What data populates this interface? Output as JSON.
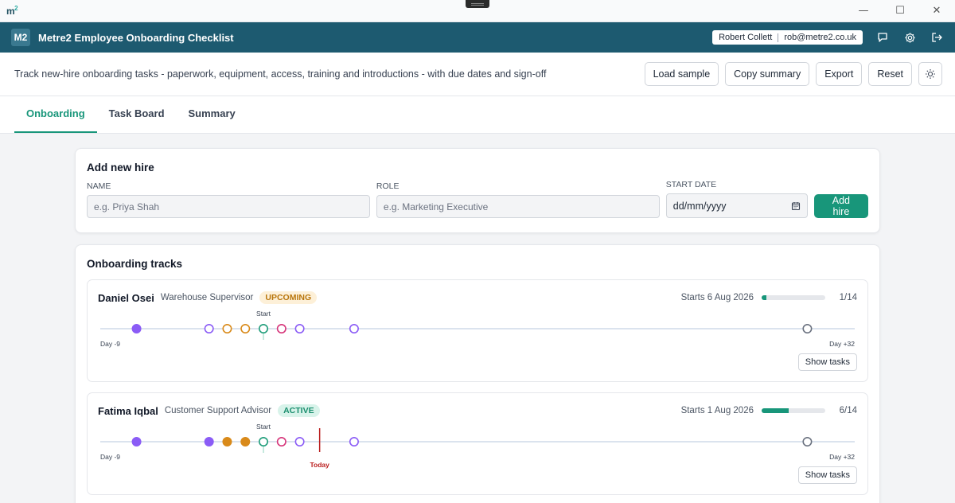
{
  "window": {
    "logo": "m",
    "logo_sup": "2",
    "minimize": "—",
    "maximize": "☐",
    "close": "✕"
  },
  "header": {
    "badge": "M2",
    "title": "Metre2 Employee Onboarding Checklist",
    "user_name": "Robert Collett",
    "user_email": "rob@metre2.co.uk"
  },
  "subheader": {
    "description": "Track new-hire onboarding tasks - paperwork, equipment, access, training and introductions - with due dates and sign-off",
    "load_sample": "Load sample",
    "copy_summary": "Copy summary",
    "export": "Export",
    "reset": "Reset"
  },
  "tabs": [
    {
      "label": "Onboarding",
      "active": true
    },
    {
      "label": "Task Board",
      "active": false
    },
    {
      "label": "Summary",
      "active": false
    }
  ],
  "add_hire": {
    "title": "Add new hire",
    "name_label": "NAME",
    "name_placeholder": "e.g. Priya Shah",
    "role_label": "ROLE",
    "role_placeholder": "e.g. Marketing Executive",
    "date_label": "START DATE",
    "date_placeholder": "dd/mm/yyyy",
    "button": "Add hire"
  },
  "tracks": {
    "title": "Onboarding tracks",
    "colors": {
      "purple": "#8b5cf6",
      "orange": "#d98a1a",
      "green": "#1f9d7a",
      "pink": "#d6357a",
      "grey": "#9ca3af",
      "today": "#b91c1c"
    },
    "items": [
      {
        "name": "Daniel Osei",
        "role": "Warehouse Supervisor",
        "status": "UPCOMING",
        "status_class": "upcoming",
        "starts": "Starts 6 Aug 2026",
        "done": 1,
        "total": 14,
        "count": "1/14",
        "day_min_label": "Day -9",
        "day_max_label": "Day +32",
        "start_label": "Start",
        "today_label": "",
        "today_day": null,
        "button": "Show tasks",
        "markers": [
          {
            "day": -7,
            "color": "purple",
            "filled": true
          },
          {
            "day": -3,
            "color": "purple",
            "filled": false
          },
          {
            "day": -2,
            "color": "orange",
            "filled": false
          },
          {
            "day": -1,
            "color": "orange",
            "filled": false
          },
          {
            "day": 0,
            "color": "green",
            "filled": false
          },
          {
            "day": 1,
            "color": "pink",
            "filled": false
          },
          {
            "day": 2,
            "color": "purple",
            "filled": false
          },
          {
            "day": 5,
            "color": "purple",
            "filled": false
          },
          {
            "day": 30,
            "color": "grey",
            "filled": false
          }
        ]
      },
      {
        "name": "Fatima Iqbal",
        "role": "Customer Support Advisor",
        "status": "ACTIVE",
        "status_class": "active",
        "starts": "Starts 1 Aug 2026",
        "done": 6,
        "total": 14,
        "count": "6/14",
        "day_min_label": "Day -9",
        "day_max_label": "Day +32",
        "start_label": "Start",
        "today_label": "Today",
        "today_day": 3.1,
        "button": "Show tasks",
        "markers": [
          {
            "day": -7,
            "color": "purple",
            "filled": true
          },
          {
            "day": -3,
            "color": "purple",
            "filled": true
          },
          {
            "day": -2,
            "color": "orange",
            "filled": true
          },
          {
            "day": -1,
            "color": "orange",
            "filled": true
          },
          {
            "day": 0,
            "color": "green",
            "filled": false
          },
          {
            "day": 1,
            "color": "pink",
            "filled": false
          },
          {
            "day": 2,
            "color": "purple",
            "filled": false
          },
          {
            "day": 5,
            "color": "purple",
            "filled": false
          },
          {
            "day": 30,
            "color": "grey",
            "filled": false
          }
        ]
      }
    ]
  }
}
